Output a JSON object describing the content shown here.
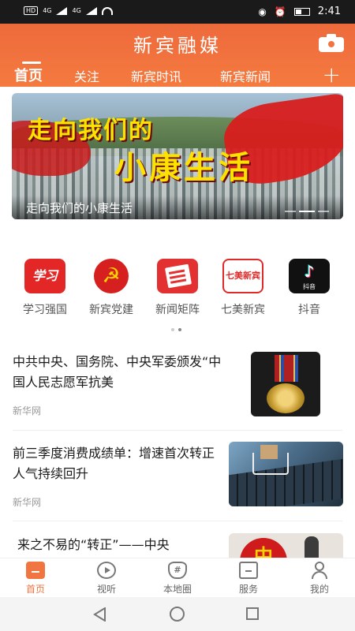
{
  "status_bar": {
    "network": "HD",
    "signal1": "4G",
    "signal2": "4G",
    "time": "2:41"
  },
  "header": {
    "app_title": "新宾融媒",
    "tabs": [
      {
        "label": "首页",
        "active": true
      },
      {
        "label": "关注",
        "active": false
      },
      {
        "label": "新宾时讯",
        "active": false
      },
      {
        "label": "新宾新闻",
        "active": false
      }
    ],
    "add_label": "+"
  },
  "banner": {
    "headline_line1": "走向我们的",
    "headline_line2": "小康生活",
    "caption": "走向我们的小康生活"
  },
  "shortcuts": [
    {
      "label": "学习强国",
      "icon": "xuexi-qiangguo-icon",
      "icon_text": "学习"
    },
    {
      "label": "新宾党建",
      "icon": "party-emblem-icon",
      "icon_text": "☭"
    },
    {
      "label": "新闻矩阵",
      "icon": "newspaper-icon",
      "icon_text": ""
    },
    {
      "label": "七美新宾",
      "icon": "qimei-xinbin-icon",
      "icon_text": "七美新宾"
    },
    {
      "label": "抖音",
      "icon": "douyin-icon",
      "icon_text": "抖音"
    }
  ],
  "news": [
    {
      "title": "中共中央、国务院、中央军委颁发“中国人民志愿军抗美",
      "source": "新华网",
      "thumb": "medal"
    },
    {
      "title": "前三季度消费成绩单：增速首次转正 人气持续回升",
      "source": "新华网",
      "thumb": "shopping-cart"
    },
    {
      "title": "来之不易的“转正”——中央",
      "source": "",
      "thumb": "zhong",
      "thumb_text": "中"
    }
  ],
  "bottom_nav": [
    {
      "label": "首页",
      "active": true
    },
    {
      "label": "视听",
      "active": false
    },
    {
      "label": "本地圈",
      "active": false
    },
    {
      "label": "服务",
      "active": false
    },
    {
      "label": "我的",
      "active": false
    }
  ],
  "colors": {
    "accent": "#f07540",
    "header": "#ee6a3c",
    "banner_text": "#fde200"
  }
}
